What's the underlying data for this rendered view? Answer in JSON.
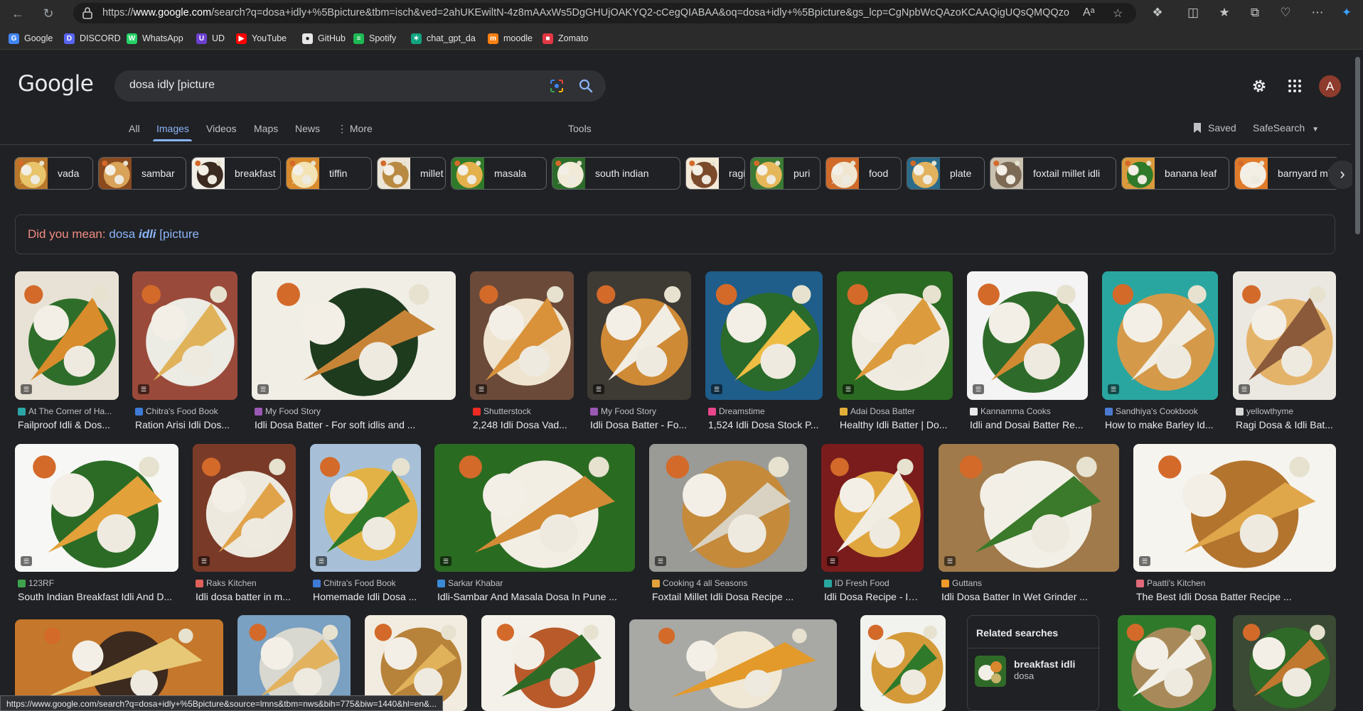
{
  "browser": {
    "url_prefix": "https://",
    "url_host": "www.google.com",
    "url_rest": "/search?q=dosa+idly+%5Bpicture&tbm=isch&ved=2ahUKEwiltN-4z8mAAxWs5DgGHUjOAKYQ2-cCegQIABAA&oq=dosa+idly+%5Bpicture&gs_lcp=CgNpbWcQAzoKCAAQigUQsQMQQzoHCAAQ...",
    "read_aloud_icon": "Aᵃ",
    "bookmarks": [
      {
        "label": "Google",
        "color": "#4285f4",
        "glyph": "G"
      },
      {
        "label": "DISCORD",
        "color": "#5865f2",
        "glyph": "D"
      },
      {
        "label": "WhatsApp",
        "color": "#25d366",
        "glyph": "W"
      },
      {
        "label": "UD",
        "color": "#6c3fd1",
        "glyph": "U"
      },
      {
        "label": "YouTube",
        "color": "#ff0000",
        "glyph": "▶"
      },
      {
        "label": "GitHub",
        "color": "#e6e6e6",
        "glyph": "●"
      },
      {
        "label": "Spotify",
        "color": "#1db954",
        "glyph": "≡"
      },
      {
        "label": "chat_gpt_da",
        "color": "#10a37f",
        "glyph": "✶"
      },
      {
        "label": "moodle",
        "color": "#f98012",
        "glyph": "m"
      },
      {
        "label": "Zomato",
        "color": "#e23744",
        "glyph": "■"
      }
    ],
    "status_url": "https://www.google.com/search?q=dosa+idly+%5Bpicture&source=lmns&tbm=nws&bih=775&biw=1440&hl=en&..."
  },
  "header": {
    "logo": "Google",
    "query": "dosa idly [picture",
    "avatar_letter": "A"
  },
  "tabs": [
    {
      "label": "All",
      "active": false
    },
    {
      "label": "Images",
      "active": true
    },
    {
      "label": "Videos",
      "active": false
    },
    {
      "label": "Maps",
      "active": false
    },
    {
      "label": "News",
      "active": false
    },
    {
      "label": "⋮ More",
      "active": false
    }
  ],
  "tools_label": "Tools",
  "saved_label": "Saved",
  "safesearch_label": "SafeSearch",
  "chips": [
    {
      "label": "vada",
      "colors": [
        "#b9772b",
        "#e8c46a"
      ]
    },
    {
      "label": "sambar",
      "colors": [
        "#8a4a1e",
        "#d9a35a"
      ]
    },
    {
      "label": "breakfast",
      "colors": [
        "#f2efe8",
        "#3b2a1f"
      ]
    },
    {
      "label": "tiffin",
      "colors": [
        "#d88a2c",
        "#f3e3b5"
      ]
    },
    {
      "label": "millet",
      "colors": [
        "#ece6d8",
        "#b98a42"
      ]
    },
    {
      "label": "masala",
      "colors": [
        "#2f7a2a",
        "#e3b04b"
      ]
    },
    {
      "label": "south indian",
      "colors": [
        "#2d6b2a",
        "#f0ead7"
      ]
    },
    {
      "label": "ragi",
      "colors": [
        "#f4e9d8",
        "#7b4a2a"
      ]
    },
    {
      "label": "puri",
      "colors": [
        "#3a7a34",
        "#e6b75a"
      ]
    },
    {
      "label": "food",
      "colors": [
        "#cf6a2a",
        "#f0e6d2"
      ]
    },
    {
      "label": "plate",
      "colors": [
        "#2a6b8a",
        "#e2b25e"
      ]
    },
    {
      "label": "foxtail millet idli",
      "colors": [
        "#c9c0b0",
        "#7d6a55"
      ]
    },
    {
      "label": "banana leaf",
      "colors": [
        "#d99a3d",
        "#2f7a2a"
      ]
    },
    {
      "label": "barnyard millet",
      "colors": [
        "#e07b2a",
        "#f4efe4"
      ]
    }
  ],
  "did_you_mean": {
    "prefix": "Did you mean:",
    "word1": "dosa",
    "word2": "idli",
    "word3": "[picture"
  },
  "results": [
    {
      "source": "At The Corner of Ha...",
      "title": "Failproof Idli & Dos...",
      "fav": "#2ba6a6",
      "colors": [
        "#e8e2d6",
        "#d98c2b",
        "#2f6e2a"
      ]
    },
    {
      "source": "Chitra's Food Book",
      "title": "Ration Arisi Idli Dos...",
      "fav": "#3d7bd6",
      "colors": [
        "#9a4a3a",
        "#e0b25a",
        "#ecebe4"
      ]
    },
    {
      "source": "My Food Story",
      "title": "Idli Dosa Batter - For soft idlis and ...",
      "fav": "#9b59b6",
      "colors": [
        "#f1eee6",
        "#c88436",
        "#1e3b1e"
      ]
    },
    {
      "source": "Shutterstock",
      "title": "2,248 Idli Dosa Vad...",
      "fav": "#ee2b24",
      "colors": [
        "#6b4a3a",
        "#d9923a",
        "#efe4cf"
      ]
    },
    {
      "source": "My Food Story",
      "title": "Idli Dosa Batter - Fo...",
      "fav": "#9b59b6",
      "colors": [
        "#3e3a34",
        "#f1ede3",
        "#cf8a36"
      ]
    },
    {
      "source": "Dreamstime",
      "title": "1,524 Idli Dosa Stock P...",
      "fav": "#e8468c",
      "colors": [
        "#1f5d8a",
        "#eebd44",
        "#2a6a2a"
      ]
    },
    {
      "source": "Adai Dosa Batter",
      "title": "Healthy Idli Batter | Do...",
      "fav": "#e2b03a",
      "colors": [
        "#2b6a22",
        "#dc9c3d",
        "#f0ebe0"
      ]
    },
    {
      "source": "Kannamma Cooks",
      "title": "Idli and Dosai Batter Re...",
      "fav": "#e8e8e8",
      "colors": [
        "#f4f4f4",
        "#d28a32",
        "#2e6b2a"
      ]
    },
    {
      "source": "Sandhiya's Cookbook",
      "title": "How to make Barley Id...",
      "fav": "#4a7bd0",
      "colors": [
        "#2aa6a0",
        "#f2ede2",
        "#d49a4a"
      ]
    },
    {
      "source": "yellowthyme",
      "title": "Ragi Dosa & Idli Bat...",
      "fav": "#d8d8d8",
      "colors": [
        "#ebe8e2",
        "#8a5a3a",
        "#e4b36a"
      ]
    },
    {
      "source": "123RF",
      "title": "South Indian Breakfast Idli And D...",
      "fav": "#3fa34d",
      "colors": [
        "#f7f7f5",
        "#e3a13a",
        "#2b6b26"
      ]
    },
    {
      "source": "Raks Kitchen",
      "title": "Idli dosa batter in m...",
      "fav": "#e0605a",
      "colors": [
        "#7a3a28",
        "#e1a34a",
        "#ede9de"
      ]
    },
    {
      "source": "Chitra's Food Book",
      "title": "Homemade Idli Dosa ...",
      "fav": "#3d7bd6",
      "colors": [
        "#a7c0d8",
        "#2f7a2a",
        "#e2b246"
      ]
    },
    {
      "source": "Sarkar Khabar",
      "title": "Idli-Sambar And Masala Dosa In Pune ...",
      "fav": "#3a8ad6",
      "colors": [
        "#2a6b22",
        "#d28a34",
        "#f2eee4"
      ]
    },
    {
      "source": "Cooking 4 all Seasons",
      "title": "Foxtail Millet Idli Dosa Recipe ...",
      "fav": "#e3a13a",
      "colors": [
        "#9a9a96",
        "#d9d2c2",
        "#c58a3a"
      ]
    },
    {
      "source": "ID Fresh Food",
      "title": "Idli Dosa Recipe - ID...",
      "fav": "#2aa6a0",
      "colors": [
        "#7a1c1c",
        "#f1ede2",
        "#e0a63e"
      ]
    },
    {
      "source": "Guttans",
      "title": "Idli Dosa Batter In Wet Grinder ...",
      "fav": "#f09a2a",
      "colors": [
        "#a07a4a",
        "#3a7a2a",
        "#f2efe6"
      ]
    },
    {
      "source": "Paatti's Kitchen",
      "title": "The Best Idli Dosa Batter Recipe ...",
      "fav": "#e26a7a",
      "colors": [
        "#f6f4ef",
        "#e0a64a",
        "#b3742e"
      ]
    },
    {
      "source": "",
      "title": "",
      "fav": "",
      "colors": [
        "#c5772b",
        "#e7c877",
        "#3d2a1e"
      ]
    },
    {
      "source": "",
      "title": "",
      "fav": "",
      "colors": [
        "#7aa0c2",
        "#e2b25e",
        "#d8d8d0"
      ]
    },
    {
      "source": "",
      "title": "",
      "fav": "",
      "colors": [
        "#f2ece0",
        "#e0b25a",
        "#b7823a"
      ]
    },
    {
      "source": "",
      "title": "",
      "fav": "",
      "colors": [
        "#f4f1ea",
        "#2e6a26",
        "#b85a2a"
      ]
    },
    {
      "source": "",
      "title": "",
      "fav": "",
      "colors": [
        "#a8a8a4",
        "#e39a2a",
        "#f0e8d4"
      ]
    },
    {
      "source": "",
      "title": "",
      "fav": "",
      "colors": [
        "#f2f2ee",
        "#2e7a2a",
        "#d49a3a"
      ]
    },
    {
      "source": "",
      "title": "",
      "fav": "",
      "colors": [
        "#2f7a2a",
        "#f2efe6",
        "#a88a5a"
      ]
    },
    {
      "source": "",
      "title": "",
      "fav": "",
      "colors": [
        "#3a4a34",
        "#c0782e",
        "#2f6a28"
      ]
    }
  ],
  "related": {
    "heading": "Related searches",
    "item_title": "breakfast idli",
    "item_sub": "dosa"
  }
}
